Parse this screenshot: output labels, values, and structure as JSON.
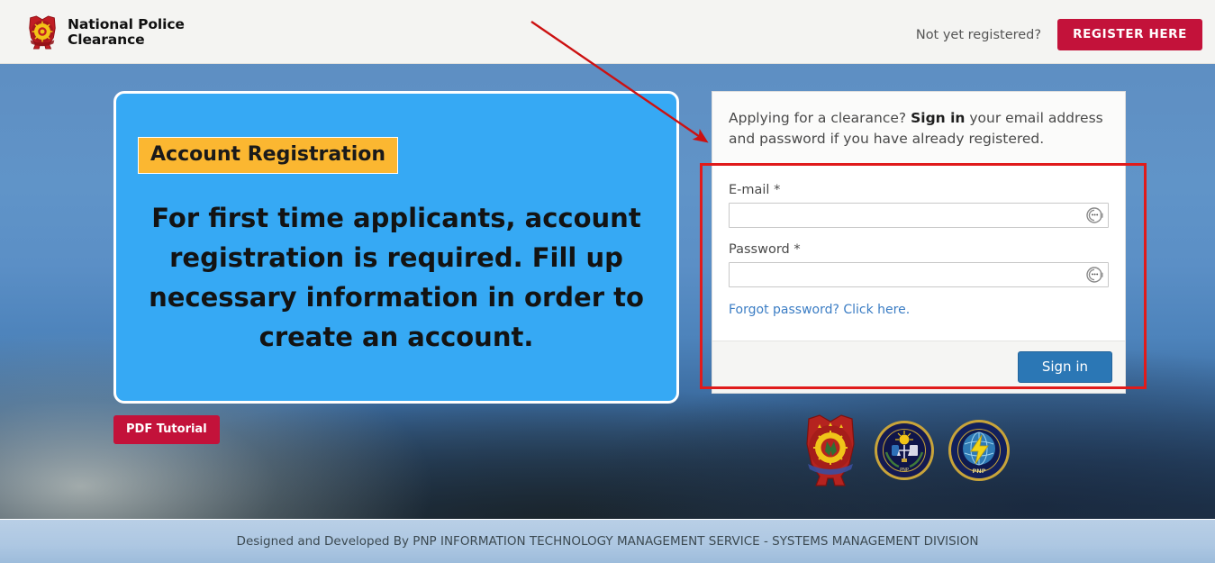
{
  "header": {
    "brand_line1": "National Police",
    "brand_line2": "Clearance",
    "logo_icon": "pnp-shield-logo-icon",
    "not_registered_text": "Not yet registered?",
    "register_button": "REGISTER HERE",
    "register_button_color": "#c3123a",
    "background_color": "#f4f4f2"
  },
  "promo": {
    "badge": "Account Registration",
    "badge_color": "#fbb731",
    "panel_color": "#36a9f4",
    "body": "For first time applicants, account registration is required. Fill up necessary information in order to create an account.",
    "pdf_button": "PDF Tutorial",
    "pdf_button_color": "#c3123a"
  },
  "signin": {
    "intro_before": "Applying for a clearance? ",
    "intro_bold": "Sign in",
    "intro_after": " your email address and password if you have already registered.",
    "email_label": "E-mail *",
    "email_value": "",
    "email_placeholder": "",
    "email_icon": "autofill-face-icon",
    "password_label": "Password *",
    "password_value": "",
    "password_placeholder": "",
    "password_icon": "autofill-face-icon",
    "forgot_link": "Forgot password? Click here.",
    "forgot_link_color": "#3b7dc4",
    "submit_button": "Sign in",
    "submit_button_color": "#2b77b5"
  },
  "seals": [
    {
      "name": "philippine-national-police-seal",
      "label": "PHILIPPINE NATIONAL POLICE"
    },
    {
      "name": "directorate-for-investigation-and-detective-management-seal",
      "label": "DIRECTORATE FOR INVESTIGATION AND DETECTIVE MANAGEMENT - PNP"
    },
    {
      "name": "information-technology-management-service-seal",
      "label": "INFORMATION TECHNOLOGY MANAGEMENT SERVICE - PNP"
    }
  ],
  "footer": {
    "text": "Designed and Developed By PNP INFORMATION TECHNOLOGY MANAGEMENT SERVICE - SYSTEMS MANAGEMENT DIVISION",
    "background_color": "#b0c9e3"
  },
  "annotations": {
    "arrow_color": "#cc1111",
    "rect_color": "#e01b1b",
    "arrow_from": "x=590,y=24",
    "arrow_to": "x=787,y=158",
    "rect_region": "x=777,y=181,w=496,h=251"
  }
}
